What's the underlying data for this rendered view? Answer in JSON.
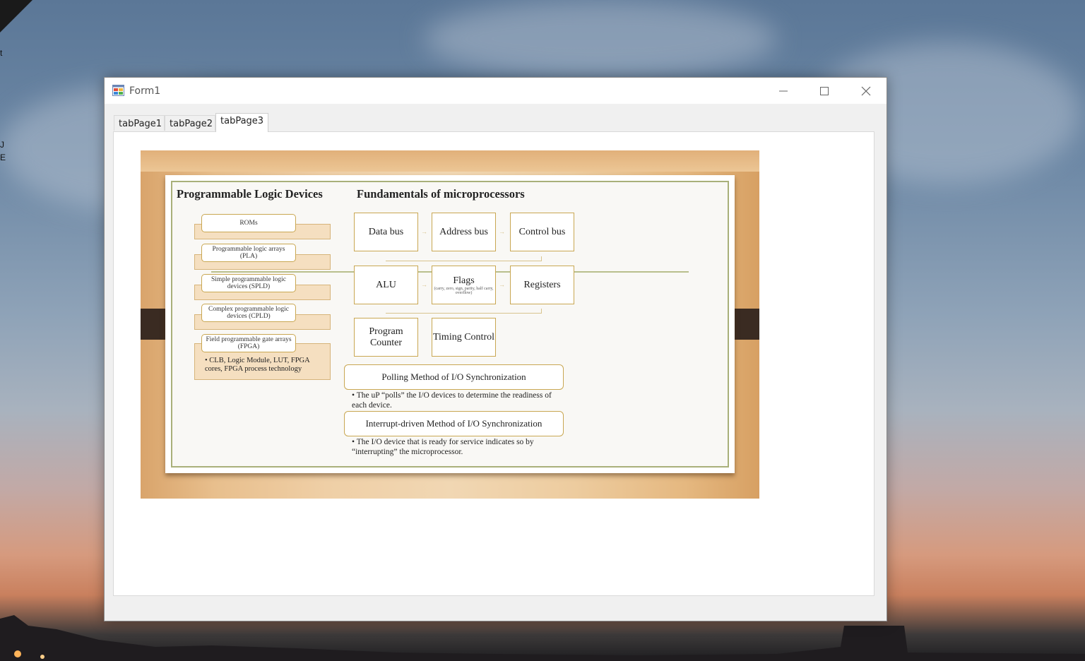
{
  "desktop": {
    "edge_labels": [
      "t",
      "J",
      "E"
    ]
  },
  "window": {
    "title": "Form1",
    "icon": "app-icon",
    "controls": [
      "minimize-icon",
      "maximize-icon",
      "close-icon"
    ]
  },
  "tabs": [
    {
      "label": "tabPage1",
      "active": false
    },
    {
      "label": "tabPage2",
      "active": false
    },
    {
      "label": "tabPage3",
      "active": true
    }
  ],
  "slide": {
    "title_left": "Programmable Logic Devices",
    "title_right": "Fundamentals of microprocessors",
    "pld_items": [
      "ROMs",
      "Programmable logic arrays (PLA)",
      "Simple programmable logic devices (SPLD)",
      "Complex programmable logic devices (CPLD)",
      "Field programmable gate arrays (FPGA)"
    ],
    "fpga_note": "• CLB, Logic Module, LUT, FPGA cores, FPGA process technology",
    "blocks": {
      "data_bus": "Data bus",
      "address_bus": "Address bus",
      "control_bus": "Control bus",
      "alu": "ALU",
      "flags": "Flags",
      "flags_detail": "(carry, zero, sign, parity, half carry, overflow)",
      "registers": "Registers",
      "program_counter": "Program Counter",
      "timing_control": "Timing Control"
    },
    "polling_title": "Polling Method of I/O Synchronization",
    "polling_text": "• The uP “polls” the I/O devices to determine the readiness of each device.",
    "interrupt_title": "Interrupt-driven Method of I/O Synchronization",
    "interrupt_text": "• The I/O device that is ready for service indicates so by “interrupting” the microprocessor."
  }
}
